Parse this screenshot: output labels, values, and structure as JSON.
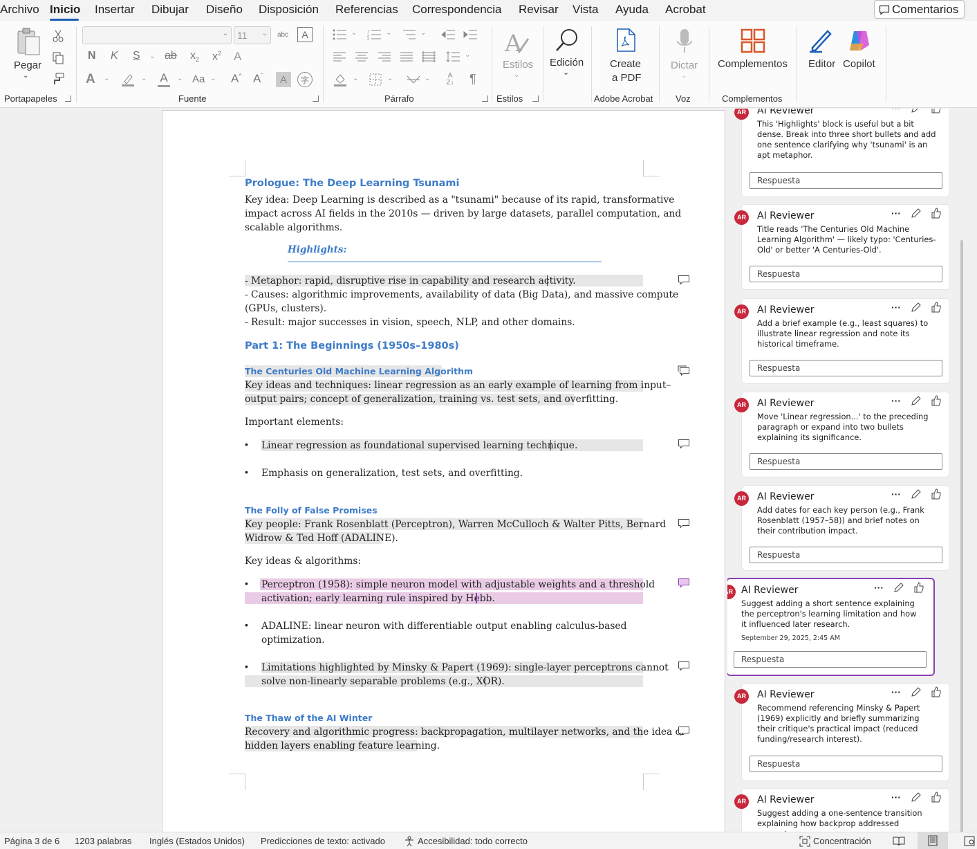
{
  "menu": {
    "tabs": [
      {
        "label": "Archivo"
      },
      {
        "label": "Inicio",
        "active": true
      },
      {
        "label": "Insertar"
      },
      {
        "label": "Dibujar"
      },
      {
        "label": "Diseño"
      },
      {
        "label": "Disposición"
      },
      {
        "label": "Referencias"
      },
      {
        "label": "Correspondencia"
      },
      {
        "label": "Revisar"
      },
      {
        "label": "Vista"
      },
      {
        "label": "Ayuda"
      },
      {
        "label": "Acrobat"
      }
    ],
    "comments_button": "Comentarios"
  },
  "ribbon": {
    "groups": {
      "clipboard": "Portapapeles",
      "font": "Fuente",
      "paragraph": "Párrafo",
      "styles": "Estilos",
      "acrobat": "Adobe Acrobat",
      "voice": "Voz",
      "addins": "Complementos"
    },
    "paste_label": "Pegar",
    "font_name": "",
    "font_size": "11",
    "bold": "N",
    "italic": "K",
    "underline": "S",
    "styles_label": "Estilos",
    "editing_label": "Edición",
    "create_pdf_line1": "Create",
    "create_pdf_line2": "a PDF",
    "dictate_label": "Dictar",
    "addins_label": "Complementos",
    "editor_label": "Editor",
    "copilot_label": "Copilot"
  },
  "document": {
    "prologue_title": "Prologue: The Deep Learning Tsunami",
    "prologue_para": [
      "Key idea: Deep Learning is described as a \"tsunami\" because of its rapid, transformative",
      "impact across AI fields in the 2010s — driven by large datasets, parallel computation, and",
      "scalable algorithms."
    ],
    "highlights_title": "Highlights:",
    "highlights": [
      "- Metaphor: rapid, disruptive rise in capability and research activity.",
      "- Causes: algorithmic improvements, availability of data (Big Data), and massive compute",
      "(GPUs, clusters).",
      "- Result: major successes in vision, speech, NLP, and other domains."
    ],
    "part1_title": "Part 1: The Beginnings (1950s–1980s)",
    "sec1_title": "The Centuries Old Machine Learning Algorithm",
    "sec1_para": [
      "Key ideas and techniques: linear regression as an early example of learning from input–",
      "output pairs; concept of generalization, training vs. test sets, and overfitting."
    ],
    "important_label": "Important elements:",
    "important_bullets": [
      "Linear regression as foundational supervised learning technique.",
      "Emphasis on generalization, test sets, and overfitting."
    ],
    "sec2_title": "The Folly of False Promises",
    "sec2_para": [
      "Key people: Frank Rosenblatt (Perceptron), Warren McCulloch & Walter Pitts, Bernard",
      "Widrow & Ted Hoff (ADALINE)."
    ],
    "keyideas_label": "Key ideas & algorithms:",
    "keyideas_bullets": [
      [
        "Perceptron (1958): simple neuron model with adjustable weights and a threshold",
        "activation; early learning rule inspired by Hebb."
      ],
      [
        "ADALINE: linear neuron with differentiable output enabling calculus-based",
        "optimization."
      ],
      [
        "Limitations highlighted by Minsky & Papert (1969): single-layer perceptrons cannot",
        "solve non-linearly separable problems (e.g., XOR)."
      ]
    ],
    "sec3_title": "The Thaw of the AI Winter",
    "sec3_para": [
      "Recovery and algorithmic progress: backpropagation, multilayer networks, and the idea of",
      "hidden layers enabling feature learning."
    ]
  },
  "comments": {
    "author": "AI Reviewer",
    "initials": "AR",
    "reply_placeholder": "Respuesta",
    "items": [
      {
        "text": "This 'Highlights' block is useful but a bit dense. Break into three short bullets and add one sentence clarifying why 'tsunami' is an apt metaphor."
      },
      {
        "text": "Title reads 'The Centuries Old Machine Learning Algorithm' — likely typo: 'Centuries-Old' or better 'A Centuries-Old'."
      },
      {
        "text": "Add a brief example (e.g., least squares) to illustrate linear regression and note its historical timeframe."
      },
      {
        "text": "Move 'Linear regression...' to the preceding paragraph or expand into two bullets explaining its significance."
      },
      {
        "text": "Add dates for each key person (e.g., Frank Rosenblatt (1957–58)) and brief notes on their contribution impact."
      },
      {
        "text": "Suggest adding a short sentence explaining the perceptron's learning limitation and how it influenced later research.",
        "date": "September 29, 2025, 2:45 AM",
        "active": true
      },
      {
        "text": "Recommend referencing Minsky & Papert (1969) explicitly and briefly summarizing their critique's practical impact (reduced funding/research interest)."
      },
      {
        "text": "Suggest adding a one-sentence transition explaining how backprop addressed perceptron"
      }
    ]
  },
  "status": {
    "page": "Página 3 de 6",
    "words": "1203 palabras",
    "language": "Inglés (Estados Unidos)",
    "predictions": "Predicciones de texto: activado",
    "accessibility": "Accesibilidad: todo correcto",
    "focus": "Concentración"
  },
  "colors": {
    "accent": "#1b5fb4",
    "heading": "#3e7cc9",
    "active_comment": "#8a3fb5",
    "avatar": "#c8283c"
  }
}
